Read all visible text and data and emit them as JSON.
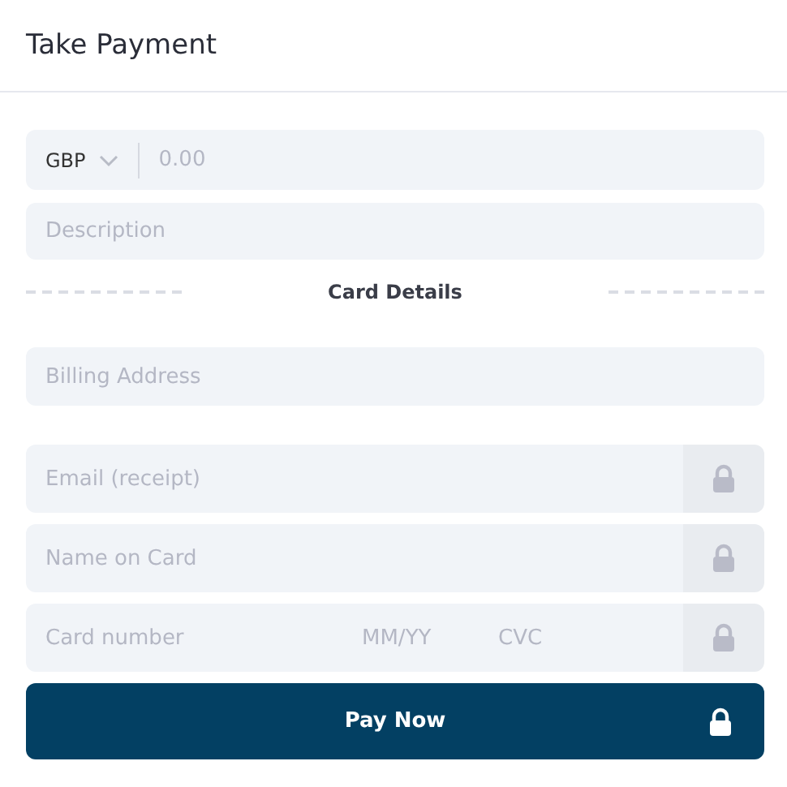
{
  "header": {
    "title": "Take Payment"
  },
  "amount": {
    "currency": "GBP",
    "placeholder": "0.00"
  },
  "description": {
    "placeholder": "Description"
  },
  "section_title": "Card Details",
  "billing": {
    "placeholder": "Billing Address"
  },
  "secure_fields": [
    {
      "placeholders": [
        "Email (receipt)"
      ]
    },
    {
      "placeholders": [
        "Name on Card"
      ]
    },
    {
      "placeholders": [
        "Card number",
        "MM/YY",
        "CVC"
      ]
    }
  ],
  "pay_button": {
    "label": "Pay Now"
  }
}
